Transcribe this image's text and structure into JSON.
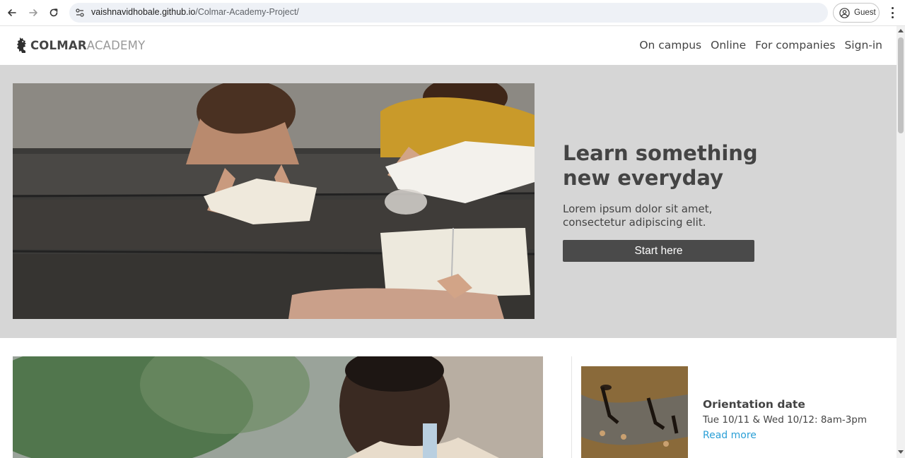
{
  "browser": {
    "url_domain": "vaishnavidhobale.github.io",
    "url_path": "/Colmar-Academy-Project/",
    "profile_label": "Guest"
  },
  "site": {
    "logo_strong": "COLMAR",
    "logo_light": "ACADEMY",
    "nav": [
      "On campus",
      "Online",
      "For companies",
      "Sign-in"
    ]
  },
  "hero": {
    "title_line1": "Learn something",
    "title_line2": "new everyday",
    "text_line1": "Lorem ipsum dolor sit amet,",
    "text_line2": "consectetur adipiscing elit.",
    "cta_label": "Start here"
  },
  "event": {
    "title": "Orientation date",
    "date": "Tue 10/11 & Wed 10/12: 8am-3pm",
    "link_label": "Read more"
  },
  "colors": {
    "hero_bg": "#d6d6d6",
    "text": "#444444",
    "button": "#4a4a4a",
    "link": "#2a9fd6"
  }
}
